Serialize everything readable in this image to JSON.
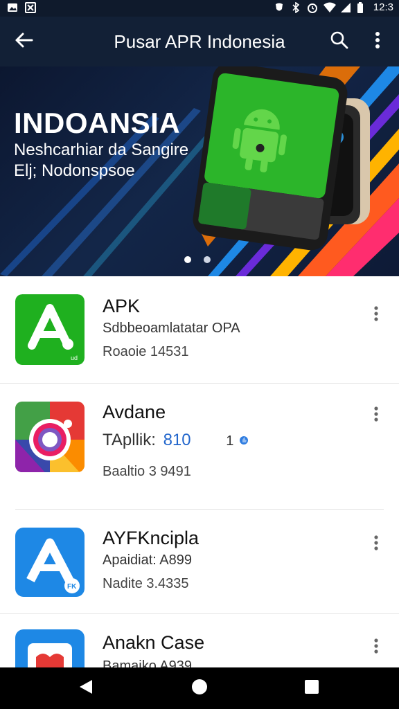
{
  "status_bar": {
    "time": "12:3",
    "left_icons": [
      "gallery-icon",
      "photo-icon"
    ],
    "right_icons": [
      "vibrate-icon",
      "bluetooth-icon",
      "alarm-icon",
      "wifi-icon",
      "signal-icon",
      "battery-icon"
    ]
  },
  "app_bar": {
    "title": "Pusar APR Indonesia",
    "back_icon": "arrow-left-icon",
    "search_icon": "search-icon",
    "more_icon": "more-vert-icon"
  },
  "banner": {
    "heading": "INDOANSIA",
    "subtitle_line1": "Neshcarhiar da Sangire",
    "subtitle_line2": "Elj; Nodonspsoe",
    "active_dot": 1,
    "dot_count": 2
  },
  "apps": [
    {
      "name": "APK",
      "description": "Sdbbeoamlatatar OPA",
      "meta": "Roaoie  14531",
      "icon": "green-a-app-icon",
      "icon_color": "#1fb01f",
      "icon_badge": "ud"
    },
    {
      "name": "Avdane",
      "description": "TApllik:",
      "description_version": "810",
      "description_count": "1",
      "meta": "Baaltio  3 9491",
      "icon": "camera-lens-app-icon",
      "icon_color": "#e53935"
    },
    {
      "name": "AYFKncipla",
      "description": "Apaidiat: A899",
      "meta": "Nadite  3.4335",
      "icon": "blue-a-app-icon",
      "icon_color": "#1e88e5",
      "icon_badge": "FK"
    },
    {
      "name": "Anakn Case",
      "description": "Bamaiko  A939",
      "icon": "puzzle-app-icon",
      "icon_color": "#1e88e5"
    }
  ],
  "nav_bar": {
    "back_icon": "nav-back-icon",
    "home_icon": "nav-home-icon",
    "recents_icon": "nav-recents-icon"
  },
  "colors": {
    "app_bar_bg": "#122036",
    "status_bar_bg": "#0f1a2c",
    "accent_blue": "#2266cc"
  }
}
